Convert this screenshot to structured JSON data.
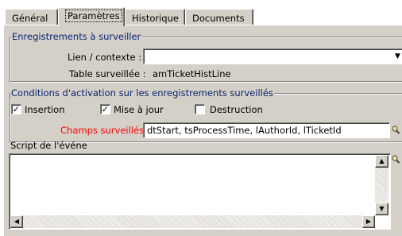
{
  "tabs": [
    {
      "label": "Général"
    },
    {
      "label": "Paramètres"
    },
    {
      "label": "Historique"
    },
    {
      "label": "Documents"
    }
  ],
  "group_watch": {
    "title": "Enregistrements à surveiller",
    "link_label": "Lien / contexte :",
    "link_value": "",
    "table_label": "Table surveillée :",
    "table_value": "amTicketHistLine"
  },
  "group_conditions": {
    "title": "Conditions d'activation sur les enregistrements surveillés",
    "insertion_label": "Insertion",
    "insertion_checked": true,
    "update_label": "Mise à jour",
    "update_checked": true,
    "destruction_label": "Destruction",
    "destruction_checked": false,
    "fields_label": "Champs surveillés :",
    "fields_value": "dtStart, tsProcessTime, lAuthorId, lTicketId",
    "fields_label_color": "#ff0000"
  },
  "script_label": "Script de l'événe",
  "script_value": "",
  "icons": [
    "magnifier-icon",
    "dropdown-arrow-icon",
    "scroll-up-icon",
    "scroll-down-icon",
    "scroll-left-icon",
    "scroll-right-icon"
  ]
}
